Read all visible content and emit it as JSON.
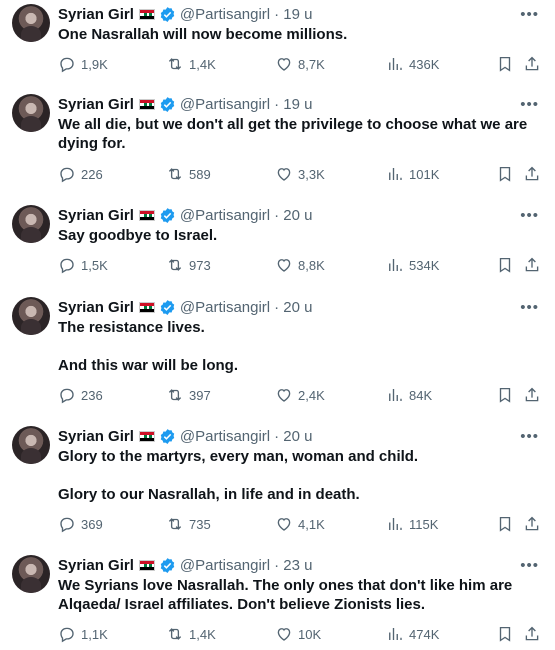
{
  "tweets": [
    {
      "name": "Syrian Girl",
      "handle": "@Partisangirl",
      "time": "· 19 u",
      "text": "One Nasrallah will now become millions.",
      "replies": "1,9K",
      "retweets": "1,4K",
      "likes": "8,7K",
      "views": "436K"
    },
    {
      "name": "Syrian Girl",
      "handle": "@Partisangirl",
      "time": "· 19 u",
      "text": "We all die, but we don't all get the privilege to choose what we are dying for.",
      "replies": "226",
      "retweets": "589",
      "likes": "3,3K",
      "views": "101K"
    },
    {
      "name": "Syrian Girl",
      "handle": "@Partisangirl",
      "time": "· 20 u",
      "text": "Say goodbye to Israel.",
      "replies": "1,5K",
      "retweets": "973",
      "likes": "8,8K",
      "views": "534K"
    },
    {
      "name": "Syrian Girl",
      "handle": "@Partisangirl",
      "time": "· 20 u",
      "text": "The resistance lives.\n\nAnd this war will be long.",
      "replies": "236",
      "retweets": "397",
      "likes": "2,4K",
      "views": "84K"
    },
    {
      "name": "Syrian Girl",
      "handle": "@Partisangirl",
      "time": "· 20 u",
      "text": "Glory to the martyrs, every man, woman and child.\n\nGlory to our Nasrallah, in life and in death.",
      "replies": "369",
      "retweets": "735",
      "likes": "4,1K",
      "views": "115K"
    },
    {
      "name": "Syrian Girl",
      "handle": "@Partisangirl",
      "time": "· 23 u",
      "text": "We Syrians love Nasrallah. The only ones that don't like him are Alqaeda/ Israel affiliates. Don't believe Zionists lies.",
      "replies": "1,1K",
      "retweets": "1,4K",
      "likes": "10K",
      "views": "474K"
    }
  ],
  "icons": {
    "verified": "verified-badge-icon",
    "more": "more-icon",
    "reply": "reply-icon",
    "retweet": "retweet-icon",
    "like": "heart-icon",
    "views": "views-icon",
    "bookmark": "bookmark-icon",
    "share": "share-icon"
  },
  "colors": {
    "verified": "#1d9bf0",
    "muted": "#536471",
    "text": "#0f1419"
  }
}
